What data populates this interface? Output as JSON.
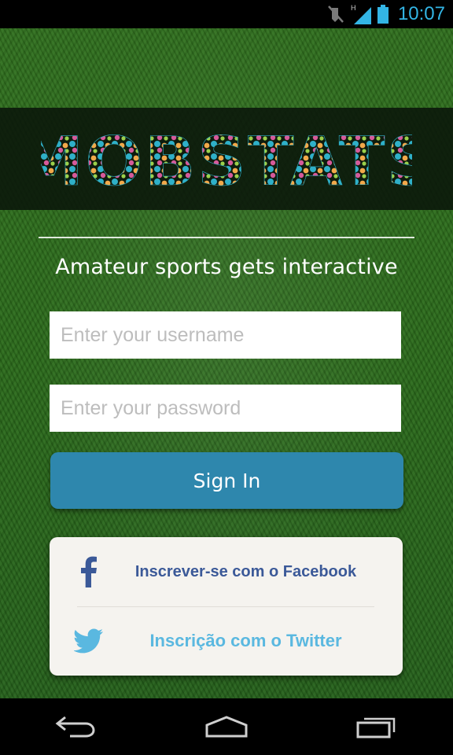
{
  "status_bar": {
    "time": "10:07",
    "network_label": "H",
    "icons": [
      "mute-icon",
      "signal-icon",
      "battery-icon"
    ],
    "accent_color": "#33b5e5"
  },
  "logo": {
    "text": "MOBSTATS"
  },
  "tagline": "Amateur sports gets interactive",
  "login": {
    "username": {
      "value": "",
      "placeholder": "Enter your username"
    },
    "password": {
      "value": "",
      "placeholder": "Enter your password"
    },
    "signin_label": "Sign In",
    "signin_color": "#2e87ad"
  },
  "social": {
    "facebook": {
      "label": "Inscrever-se com o Facebook",
      "icon": "facebook-icon",
      "color": "#3b5998"
    },
    "twitter": {
      "label": "Inscrição com o Twitter",
      "icon": "twitter-icon",
      "color": "#5ab8e0"
    }
  },
  "nav_bar": {
    "buttons": [
      "back-icon",
      "home-icon",
      "recent-apps-icon"
    ]
  }
}
